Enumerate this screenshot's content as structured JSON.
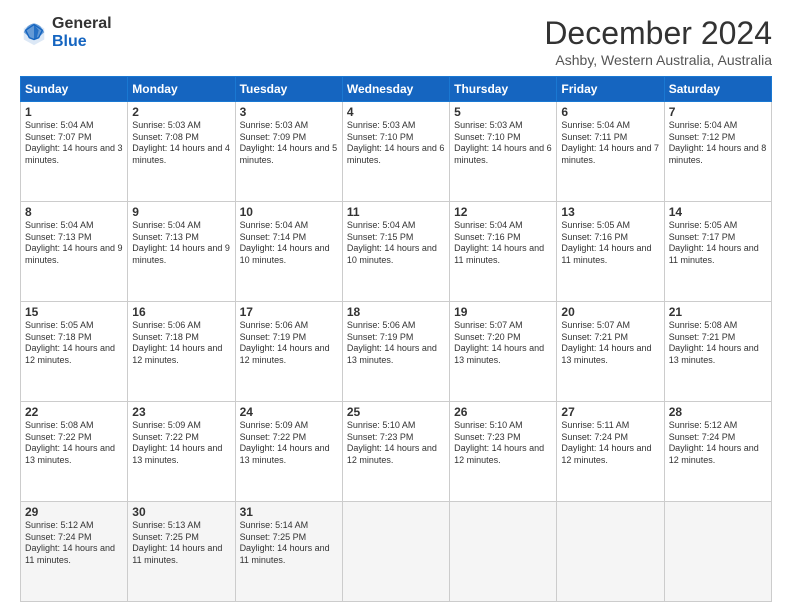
{
  "logo": {
    "general": "General",
    "blue": "Blue"
  },
  "title": "December 2024",
  "subtitle": "Ashby, Western Australia, Australia",
  "days": [
    "Sunday",
    "Monday",
    "Tuesday",
    "Wednesday",
    "Thursday",
    "Friday",
    "Saturday"
  ],
  "cells": [
    [
      {
        "day": "1",
        "sunrise": "Sunrise: 5:04 AM",
        "sunset": "Sunset: 7:07 PM",
        "daylight": "Daylight: 14 hours and 3 minutes."
      },
      {
        "day": "2",
        "sunrise": "Sunrise: 5:03 AM",
        "sunset": "Sunset: 7:08 PM",
        "daylight": "Daylight: 14 hours and 4 minutes."
      },
      {
        "day": "3",
        "sunrise": "Sunrise: 5:03 AM",
        "sunset": "Sunset: 7:09 PM",
        "daylight": "Daylight: 14 hours and 5 minutes."
      },
      {
        "day": "4",
        "sunrise": "Sunrise: 5:03 AM",
        "sunset": "Sunset: 7:10 PM",
        "daylight": "Daylight: 14 hours and 6 minutes."
      },
      {
        "day": "5",
        "sunrise": "Sunrise: 5:03 AM",
        "sunset": "Sunset: 7:10 PM",
        "daylight": "Daylight: 14 hours and 6 minutes."
      },
      {
        "day": "6",
        "sunrise": "Sunrise: 5:04 AM",
        "sunset": "Sunset: 7:11 PM",
        "daylight": "Daylight: 14 hours and 7 minutes."
      },
      {
        "day": "7",
        "sunrise": "Sunrise: 5:04 AM",
        "sunset": "Sunset: 7:12 PM",
        "daylight": "Daylight: 14 hours and 8 minutes."
      }
    ],
    [
      {
        "day": "8",
        "sunrise": "Sunrise: 5:04 AM",
        "sunset": "Sunset: 7:13 PM",
        "daylight": "Daylight: 14 hours and 9 minutes."
      },
      {
        "day": "9",
        "sunrise": "Sunrise: 5:04 AM",
        "sunset": "Sunset: 7:13 PM",
        "daylight": "Daylight: 14 hours and 9 minutes."
      },
      {
        "day": "10",
        "sunrise": "Sunrise: 5:04 AM",
        "sunset": "Sunset: 7:14 PM",
        "daylight": "Daylight: 14 hours and 10 minutes."
      },
      {
        "day": "11",
        "sunrise": "Sunrise: 5:04 AM",
        "sunset": "Sunset: 7:15 PM",
        "daylight": "Daylight: 14 hours and 10 minutes."
      },
      {
        "day": "12",
        "sunrise": "Sunrise: 5:04 AM",
        "sunset": "Sunset: 7:16 PM",
        "daylight": "Daylight: 14 hours and 11 minutes."
      },
      {
        "day": "13",
        "sunrise": "Sunrise: 5:05 AM",
        "sunset": "Sunset: 7:16 PM",
        "daylight": "Daylight: 14 hours and 11 minutes."
      },
      {
        "day": "14",
        "sunrise": "Sunrise: 5:05 AM",
        "sunset": "Sunset: 7:17 PM",
        "daylight": "Daylight: 14 hours and 11 minutes."
      }
    ],
    [
      {
        "day": "15",
        "sunrise": "Sunrise: 5:05 AM",
        "sunset": "Sunset: 7:18 PM",
        "daylight": "Daylight: 14 hours and 12 minutes."
      },
      {
        "day": "16",
        "sunrise": "Sunrise: 5:06 AM",
        "sunset": "Sunset: 7:18 PM",
        "daylight": "Daylight: 14 hours and 12 minutes."
      },
      {
        "day": "17",
        "sunrise": "Sunrise: 5:06 AM",
        "sunset": "Sunset: 7:19 PM",
        "daylight": "Daylight: 14 hours and 12 minutes."
      },
      {
        "day": "18",
        "sunrise": "Sunrise: 5:06 AM",
        "sunset": "Sunset: 7:19 PM",
        "daylight": "Daylight: 14 hours and 13 minutes."
      },
      {
        "day": "19",
        "sunrise": "Sunrise: 5:07 AM",
        "sunset": "Sunset: 7:20 PM",
        "daylight": "Daylight: 14 hours and 13 minutes."
      },
      {
        "day": "20",
        "sunrise": "Sunrise: 5:07 AM",
        "sunset": "Sunset: 7:21 PM",
        "daylight": "Daylight: 14 hours and 13 minutes."
      },
      {
        "day": "21",
        "sunrise": "Sunrise: 5:08 AM",
        "sunset": "Sunset: 7:21 PM",
        "daylight": "Daylight: 14 hours and 13 minutes."
      }
    ],
    [
      {
        "day": "22",
        "sunrise": "Sunrise: 5:08 AM",
        "sunset": "Sunset: 7:22 PM",
        "daylight": "Daylight: 14 hours and 13 minutes."
      },
      {
        "day": "23",
        "sunrise": "Sunrise: 5:09 AM",
        "sunset": "Sunset: 7:22 PM",
        "daylight": "Daylight: 14 hours and 13 minutes."
      },
      {
        "day": "24",
        "sunrise": "Sunrise: 5:09 AM",
        "sunset": "Sunset: 7:22 PM",
        "daylight": "Daylight: 14 hours and 13 minutes."
      },
      {
        "day": "25",
        "sunrise": "Sunrise: 5:10 AM",
        "sunset": "Sunset: 7:23 PM",
        "daylight": "Daylight: 14 hours and 12 minutes."
      },
      {
        "day": "26",
        "sunrise": "Sunrise: 5:10 AM",
        "sunset": "Sunset: 7:23 PM",
        "daylight": "Daylight: 14 hours and 12 minutes."
      },
      {
        "day": "27",
        "sunrise": "Sunrise: 5:11 AM",
        "sunset": "Sunset: 7:24 PM",
        "daylight": "Daylight: 14 hours and 12 minutes."
      },
      {
        "day": "28",
        "sunrise": "Sunrise: 5:12 AM",
        "sunset": "Sunset: 7:24 PM",
        "daylight": "Daylight: 14 hours and 12 minutes."
      }
    ],
    [
      {
        "day": "29",
        "sunrise": "Sunrise: 5:12 AM",
        "sunset": "Sunset: 7:24 PM",
        "daylight": "Daylight: 14 hours and 11 minutes."
      },
      {
        "day": "30",
        "sunrise": "Sunrise: 5:13 AM",
        "sunset": "Sunset: 7:25 PM",
        "daylight": "Daylight: 14 hours and 11 minutes."
      },
      {
        "day": "31",
        "sunrise": "Sunrise: 5:14 AM",
        "sunset": "Sunset: 7:25 PM",
        "daylight": "Daylight: 14 hours and 11 minutes."
      },
      null,
      null,
      null,
      null
    ]
  ]
}
